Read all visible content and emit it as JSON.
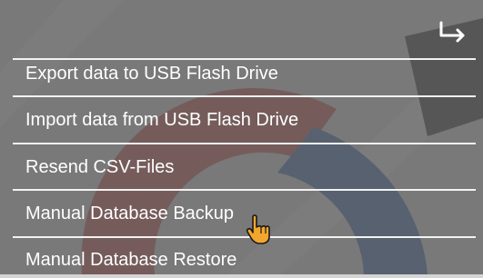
{
  "header": {
    "back_icon": "return-arrow-icon"
  },
  "menu": {
    "items": [
      {
        "label": "Export data to USB Flash Drive"
      },
      {
        "label": "Import data from USB Flash Drive"
      },
      {
        "label": "Resend CSV-Files"
      },
      {
        "label": "Manual Database Backup"
      },
      {
        "label": "Manual Database Restore"
      }
    ]
  },
  "colors": {
    "overlay": "#5f5f5f",
    "text": "#ffffff",
    "divider": "#f2f2f2",
    "logo_red": "#c4514d",
    "logo_blue": "#3f6aa8",
    "cursor_fill": "#f3a62e"
  }
}
